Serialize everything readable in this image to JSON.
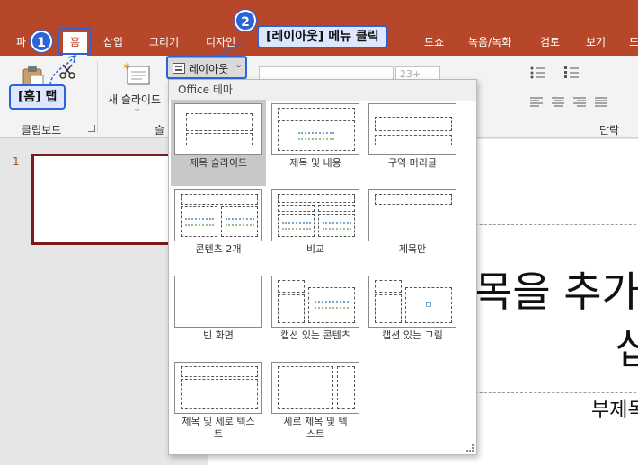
{
  "tabs": [
    {
      "label": "파",
      "active": false
    },
    {
      "label": "홈",
      "active": true
    },
    {
      "label": "삽입",
      "active": false
    },
    {
      "label": "그리기",
      "active": false
    },
    {
      "label": "디자인",
      "active": false
    },
    {
      "label": "드쇼",
      "active": false
    },
    {
      "label": "녹음/녹화",
      "active": false
    },
    {
      "label": "검토",
      "active": false
    },
    {
      "label": "보기",
      "active": false
    },
    {
      "label": "도",
      "active": false
    }
  ],
  "ribbon": {
    "new_slide_label": "새 슬라이드",
    "new_slide_arrow": "⌄",
    "layout_button_label": "레이아웃",
    "layout_button_arrow": "⌄",
    "font_size": "23+",
    "clipboard_group": "클립보드",
    "slides_group_partial": "슬",
    "paragraph_group": "단락"
  },
  "thumbnail": {
    "number": "1"
  },
  "slide": {
    "title_text": "목을 추가",
    "title_line2": "십",
    "subtitle_text": "부제목"
  },
  "dropdown": {
    "header": "Office 테마",
    "layouts": [
      {
        "name": "제목 슬라이드",
        "selected": true
      },
      {
        "name": "제목 및 내용",
        "selected": false
      },
      {
        "name": "구역 머리글",
        "selected": false
      },
      {
        "name": "콘텐츠 2개",
        "selected": false
      },
      {
        "name": "비교",
        "selected": false
      },
      {
        "name": "제목만",
        "selected": false
      },
      {
        "name": "빈 화면",
        "selected": false
      },
      {
        "name": "캡션 있는 콘텐츠",
        "selected": false
      },
      {
        "name": "캡션 있는 그림",
        "selected": false
      },
      {
        "name": "제목 및 세로 텍스트",
        "selected": false
      },
      {
        "name": "세로 제목 및 텍스트",
        "selected": false
      }
    ]
  },
  "annotations": {
    "step1_number": "1",
    "step1_label": "[홈] 탭",
    "step2_number": "2",
    "step2_label": "[레이아웃] 메뉴 클릭"
  },
  "colors": {
    "accent": "#b7472a",
    "annotation": "#2b63d9",
    "slide_border": "#7a1c1c"
  }
}
